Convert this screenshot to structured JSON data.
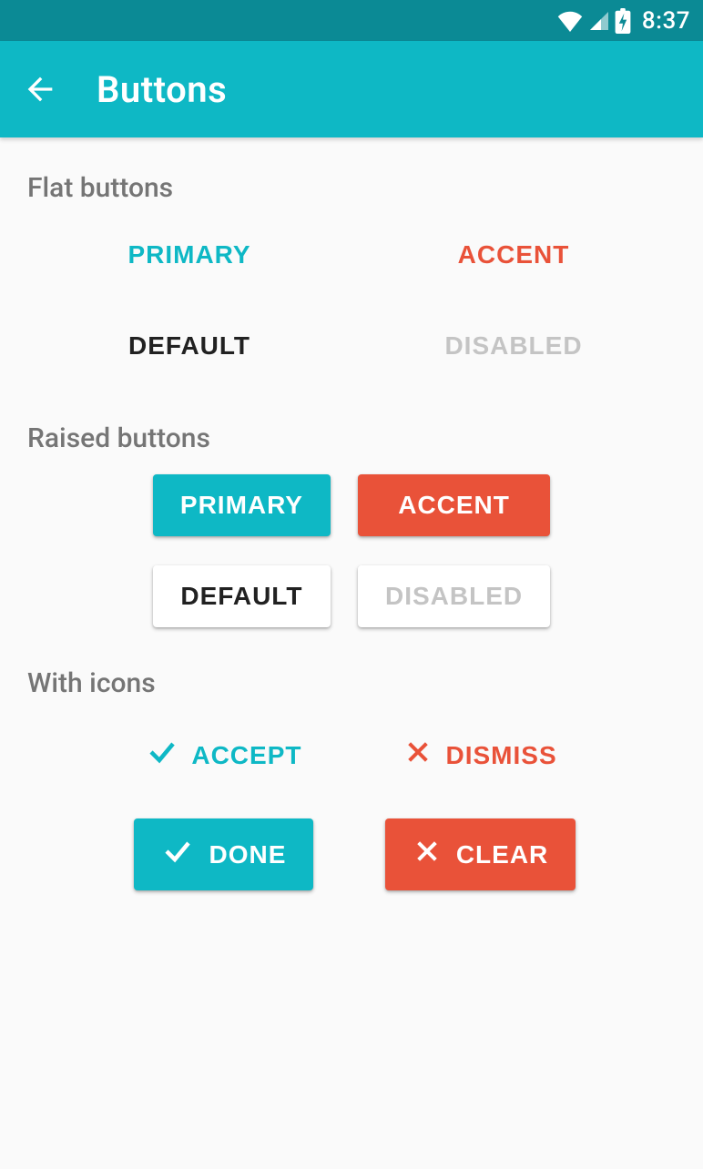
{
  "status": {
    "time": "8:37"
  },
  "appbar": {
    "title": "Buttons"
  },
  "sections": {
    "flat_title": "Flat buttons",
    "raised_title": "Raised buttons",
    "icons_title": "With icons"
  },
  "flat": {
    "primary": "PRIMARY",
    "accent": "ACCENT",
    "default": "DEFAULT",
    "disabled": "DISABLED"
  },
  "raised": {
    "primary": "PRIMARY",
    "accent": "ACCENT",
    "default": "DEFAULT",
    "disabled": "DISABLED"
  },
  "icon_buttons": {
    "accept": "ACCEPT",
    "dismiss": "DISMISS",
    "done": "DONE",
    "clear": "CLEAR"
  },
  "colors": {
    "primary": "#0eb8c5",
    "accent": "#e95239",
    "status_bar": "#0b8a95",
    "disabled_text": "#c4c4c4",
    "section_text": "#757575"
  }
}
